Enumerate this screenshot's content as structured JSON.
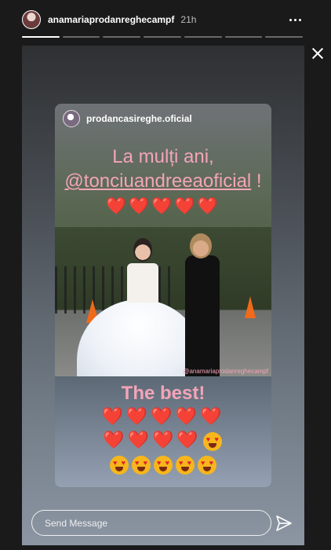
{
  "header": {
    "username": "anamariaprodanreghecampf",
    "timestamp": "21h",
    "progress_segments": 7,
    "progress_done": 1
  },
  "post": {
    "username": "prodancasireghe.oficial",
    "greeting_line1": "La mulți ani,",
    "mention": "@tonciuandreeaoficial",
    "mention_suffix": " !",
    "hearts_top": "❤️❤️❤️❤️❤️",
    "photo_watermark": "@anamariaprodanreghecampf",
    "caption": "The best!",
    "hearts_row1": "❤️❤️❤️❤️❤️",
    "hearts_row2": "❤️❤️❤️❤️",
    "faces_row2_count": 1,
    "faces_row3_count": 5
  },
  "reply": {
    "placeholder": "Send Message"
  },
  "colors": {
    "accent_pink": "#f3a4b8",
    "heart_red": "#e0202e"
  }
}
